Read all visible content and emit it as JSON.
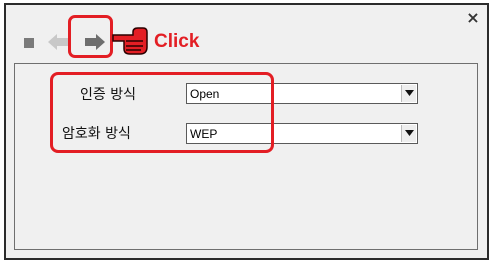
{
  "window": {
    "close_glyph": "×"
  },
  "toolbar": {
    "stop_icon": "stop-icon",
    "back_icon": "back-arrow-icon",
    "forward_icon": "forward-arrow-icon",
    "annotation_icon": "pointing-hand-icon",
    "annotation_label": "Click"
  },
  "form": {
    "auth_label": "인증 방식",
    "auth_value": "Open",
    "encryption_label": "암호화 방식",
    "encryption_value": "WEP"
  },
  "colors": {
    "highlight": "#e31e24",
    "panel": "#f0f0f0",
    "disabled_icon": "#c8c8c8",
    "active_icon": "#6e6e6e"
  }
}
